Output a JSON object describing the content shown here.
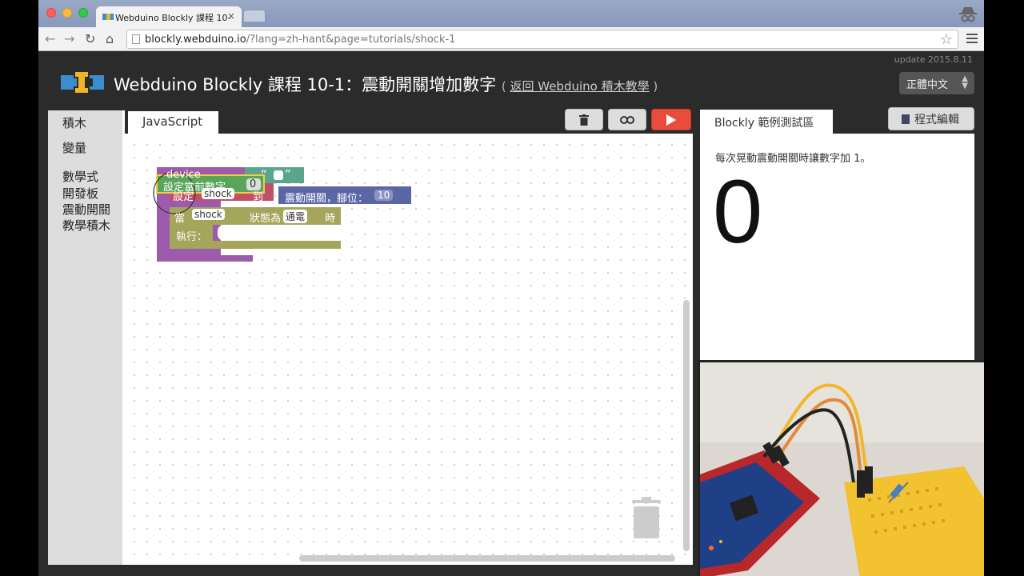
{
  "browser": {
    "tab_title": "Webduino Blockly 課程 10-",
    "tab_close": "×",
    "url_host": "blockly.webduino.io",
    "url_path": "/?lang=zh-hant&page=tutorials/shock-1",
    "back_icon": "←",
    "forward_icon": "→",
    "reload_icon": "↻",
    "home_icon": "⌂",
    "star_icon": "☆"
  },
  "header": {
    "update": "update 2015.8.11",
    "title": "Webduino Blockly 課程 10-1：震動開關增加數字",
    "sub_prefix": "( ",
    "sub_link": "返回 Webduino 積木教學",
    "sub_suffix": " )",
    "language": "正體中文"
  },
  "toolbox": {
    "items": [
      "積木",
      "變量",
      "數學式",
      "開發板",
      "震動開關",
      "教學積木"
    ]
  },
  "editor": {
    "tab_label": "JavaScript"
  },
  "blocks": {
    "device_label": "device",
    "quote_open": "“",
    "quote_close": "”",
    "set_number": "設定當前數字",
    "number_value": "0",
    "set_label": "設定",
    "var_shock": "shock",
    "to_label": "到",
    "shock_sensor": "震動開關，腳位：",
    "pin_value": "10",
    "when_label": "當",
    "state_label": "狀態為",
    "state_value": "通電",
    "time_label": "時",
    "do_label": "執行："
  },
  "demo": {
    "tab_label": "Blockly 範例測試區",
    "editor_button": "程式編輯",
    "description": "每次晃動震動開關時讓數字加 1。",
    "number": "0"
  },
  "colors": {
    "accent_run": "#e74c3c",
    "block_purple": "#9c5bad",
    "block_teal": "#5ba58c",
    "block_green": "#5ba55b",
    "block_olive": "#a5a55b",
    "block_indigo": "#5b67a5"
  }
}
